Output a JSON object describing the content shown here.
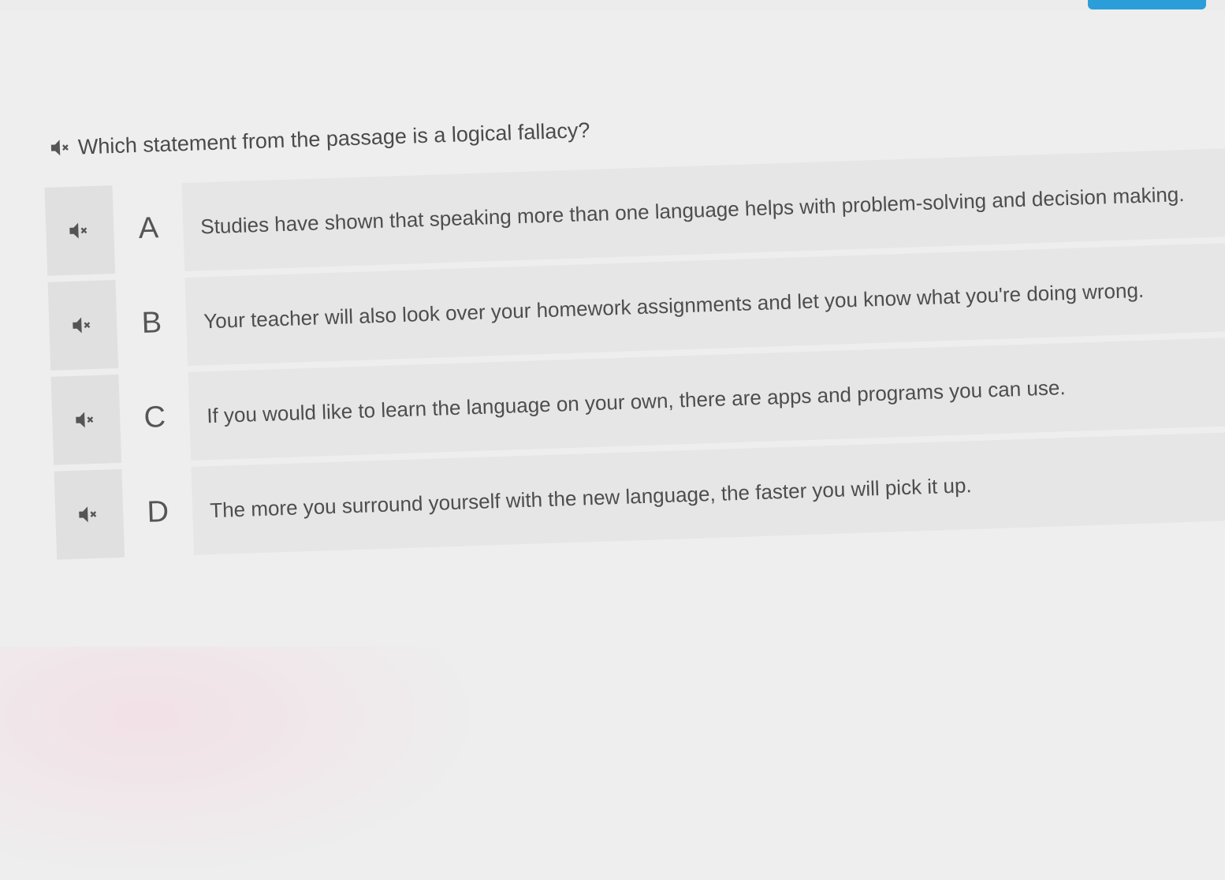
{
  "question": {
    "text": "Which statement from the passage is a logical fallacy?",
    "audio_icon": "speaker-mute-icon"
  },
  "choices": [
    {
      "letter": "A",
      "text": "Studies have shown that speaking more than one language helps with problem-solving and decision making."
    },
    {
      "letter": "B",
      "text": "Your teacher will also look over your homework assignments and let you know what you're doing wrong."
    },
    {
      "letter": "C",
      "text": "If you would like to learn the language on your own, there are apps and programs you can use."
    },
    {
      "letter": "D",
      "text": "The more you surround yourself with the new language, the faster you will pick it up."
    }
  ],
  "colors": {
    "accent": "#2b9ed9",
    "text": "#4d4d4d",
    "choice_bg": "#e6e6e6",
    "audio_bg": "#e0e0e0"
  }
}
